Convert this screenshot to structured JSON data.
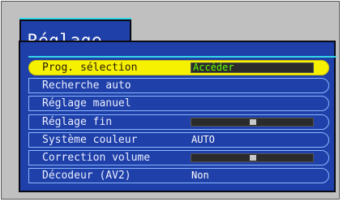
{
  "menu": {
    "title": "Réglage",
    "items": [
      {
        "label": "Prog. sélection",
        "value": "Accéder",
        "selected": true,
        "control": "box"
      },
      {
        "label": "Recherche auto",
        "value": null,
        "selected": false,
        "control": "none"
      },
      {
        "label": "Réglage manuel",
        "value": null,
        "selected": false,
        "control": "none"
      },
      {
        "label": "Réglage fin",
        "value": null,
        "selected": false,
        "control": "slider",
        "slider_level": 0.5
      },
      {
        "label": "Système couleur",
        "value": "AUTO",
        "selected": false,
        "control": "text"
      },
      {
        "label": "Correction volume",
        "value": null,
        "selected": false,
        "control": "slider",
        "slider_level": 0.5
      },
      {
        "label": "Décodeur (AV2)",
        "value": "Non",
        "selected": false,
        "control": "text"
      }
    ]
  },
  "colors": {
    "panel_bg": "#1f40a8",
    "accent_cyan": "#35d7e8",
    "highlight_yellow": "#f6f100",
    "value_green": "#66ff00"
  }
}
